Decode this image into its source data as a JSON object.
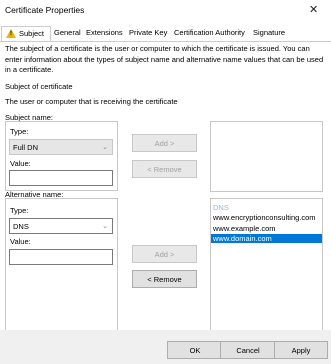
{
  "window": {
    "title": "Certificate Properties",
    "close_glyph": "✕"
  },
  "tabs": [
    {
      "label": "Subject"
    },
    {
      "label": "General"
    },
    {
      "label": "Extensions"
    },
    {
      "label": "Private Key"
    },
    {
      "label": "Certification Authority"
    },
    {
      "label": "Signature"
    }
  ],
  "description": "The subject of a certificate is the user or computer to which the certificate is issued. You can enter information about the types of subject name and alternative name values that can be used in a certificate.",
  "subject_of_certificate": {
    "heading": "Subject of certificate",
    "subtext": "The user or computer that is receiving the certificate"
  },
  "subject_name": {
    "label": "Subject name:",
    "type_label": "Type:",
    "type_value": "Full DN",
    "value_label": "Value:",
    "value": "",
    "add_label": "Add >",
    "remove_label": "< Remove"
  },
  "alternative_name": {
    "label": "Alternative name:",
    "type_label": "Type:",
    "type_value": "DNS",
    "value_label": "Value:",
    "value": "",
    "add_label": "Add >",
    "remove_label": "< Remove",
    "list": [
      {
        "text": "DNS",
        "kind": "header"
      },
      {
        "text": "www.encryptionconsulting.com",
        "kind": "item"
      },
      {
        "text": "www.example.com",
        "kind": "item"
      },
      {
        "text": "www.domain.com",
        "kind": "selected"
      }
    ]
  },
  "footer": {
    "ok": "OK",
    "cancel": "Cancel",
    "apply": "Apply"
  },
  "colors": {
    "selection": "#0078d7",
    "list_header": "#8fb8e0",
    "warning": "#e8b400"
  }
}
